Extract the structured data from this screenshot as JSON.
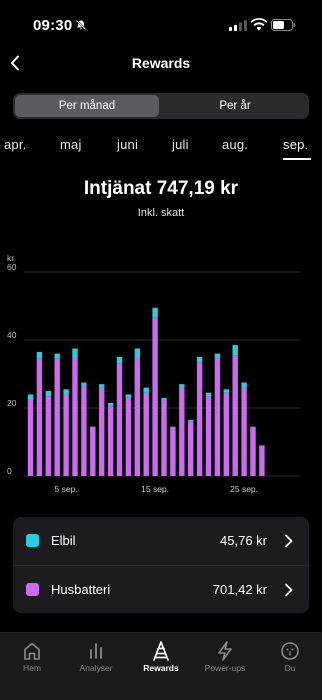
{
  "status_bar": {
    "time": "09:30"
  },
  "header": {
    "title": "Rewards"
  },
  "segmented_control": {
    "options": [
      "Per månad",
      "Per år"
    ],
    "selected": "Per månad"
  },
  "months": {
    "items": [
      "apr.",
      "maj",
      "juni",
      "juli",
      "aug.",
      "sep."
    ],
    "selected": "sep."
  },
  "summary": {
    "total": "Intjänat 747,19 kr",
    "subtitle": "Inkl. skatt"
  },
  "chart_data": {
    "type": "bar",
    "stacked": true,
    "unit_label": "kr",
    "ylim": [
      0,
      60
    ],
    "yticks": [
      "0",
      "20",
      "40",
      "60"
    ],
    "xtick_labels": [
      {
        "day": 5,
        "label": "5 sep."
      },
      {
        "day": 15,
        "label": "15 sep."
      },
      {
        "day": 25,
        "label": "25 sep."
      }
    ],
    "x": [
      1,
      2,
      3,
      4,
      5,
      6,
      7,
      8,
      9,
      10,
      11,
      12,
      13,
      14,
      15,
      16,
      17,
      18,
      19,
      20,
      21,
      22,
      23,
      24,
      25,
      26,
      27,
      28,
      29,
      30
    ],
    "series": [
      {
        "name": "Husbatteri",
        "color": "#cc6bf0",
        "values": [
          22.5,
          34.5,
          23.5,
          34.5,
          24,
          35,
          26.5,
          14.5,
          26,
          20.5,
          33,
          23,
          35,
          24.5,
          46.5,
          22.5,
          14.5,
          26,
          16,
          33.5,
          23.5,
          35,
          24.5,
          35.5,
          26,
          14.5,
          9
        ]
      },
      {
        "name": "Elbil",
        "color": "#28cde0",
        "values": [
          1.5,
          2,
          1.5,
          1.5,
          1.5,
          2.5,
          1,
          0,
          1,
          1,
          2,
          1,
          2.5,
          1.5,
          3,
          0.5,
          0,
          1,
          0.5,
          1.5,
          1,
          1,
          1,
          3,
          1.5,
          0,
          0
        ]
      }
    ]
  },
  "legend": [
    {
      "name": "Elbil",
      "value": "45,76 kr",
      "color": "#28cde0"
    },
    {
      "name": "Husbatteri",
      "value": "701,42 kr",
      "color": "#cc6bf0"
    }
  ],
  "tabbar": {
    "items": [
      {
        "label": "Hem",
        "icon": "home-icon"
      },
      {
        "label": "Analyser",
        "icon": "analytics-icon"
      },
      {
        "label": "Rewards",
        "icon": "rewards-icon"
      },
      {
        "label": "Power-ups",
        "icon": "bolt-icon"
      },
      {
        "label": "Du",
        "icon": "profile-icon"
      }
    ],
    "active": "Rewards"
  }
}
